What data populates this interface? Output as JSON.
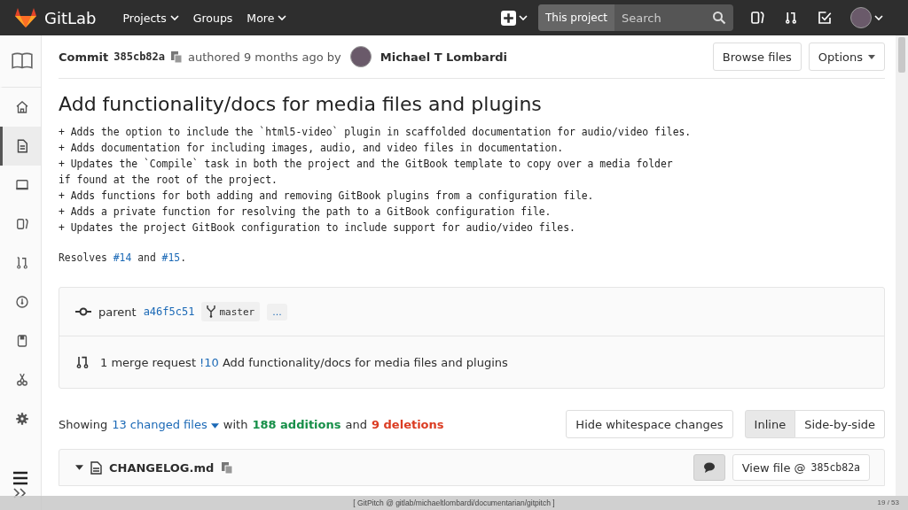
{
  "navbar": {
    "logo": "GitLab",
    "menus": [
      {
        "label": "Projects",
        "dropdown": true
      },
      {
        "label": "Groups",
        "dropdown": false
      },
      {
        "label": "More",
        "dropdown": true
      }
    ],
    "search": {
      "scope": "This project",
      "placeholder": "Search"
    }
  },
  "sidebar": {
    "items": [
      {
        "kind": "book",
        "selected": false
      },
      {
        "kind": "home",
        "selected": false
      },
      {
        "kind": "file",
        "selected": true
      },
      {
        "kind": "monitor",
        "selected": false
      },
      {
        "kind": "board",
        "selected": false
      },
      {
        "kind": "merge",
        "selected": false
      },
      {
        "kind": "gauge",
        "selected": false
      },
      {
        "kind": "snippet",
        "selected": false
      },
      {
        "kind": "scissors",
        "selected": false
      },
      {
        "kind": "gear",
        "selected": false
      }
    ]
  },
  "commit": {
    "label": "Commit",
    "sha": "385cb82a",
    "authored": "authored 9 months ago by",
    "author": "Michael T Lombardi",
    "buttons": [
      {
        "label": "Browse files",
        "dropdown": false
      },
      {
        "label": "Options",
        "dropdown": true
      }
    ]
  },
  "title": "Add functionality/docs for media files and plugins",
  "description": [
    "+ Adds the option to include the `html5-video` plugin in scaffolded documentation for audio/video files.",
    "+ Adds documentation for including images, audio, and video files in documentation.",
    "+ Updates the `Compile` task in both the project and the GitBook template to copy over a media folder",
    "if found at the root of the project.",
    "+ Adds functions for both adding and removing GitBook plugins from a configuration file.",
    "+ Adds a private function for resolving the path to a GitBook configuration file.",
    "+ Updates the project GitBook configuration to include support for audio/video files."
  ],
  "resolves": [
    {
      "kind": "text",
      "text": "Resolves "
    },
    {
      "kind": "link",
      "text": "#14"
    },
    {
      "kind": "text",
      "text": " and "
    },
    {
      "kind": "link",
      "text": "#15"
    },
    {
      "kind": "text",
      "text": "."
    }
  ],
  "info": {
    "parent_label": "parent",
    "parent_sha": "a46f5c51",
    "branch": "master",
    "more": "...",
    "merge_count": "1 merge request",
    "merge_id": "!10",
    "merge_title": "Add functionality/docs for media files and plugins"
  },
  "stats": {
    "showing": "Showing",
    "changed": "13 changed files",
    "with": "with",
    "additions": "188 additions",
    "and": "and",
    "deletions": "9 deletions",
    "whitespace_button": "Hide whitespace changes",
    "views": [
      {
        "label": "Inline",
        "selected": true
      },
      {
        "label": "Side-by-side",
        "selected": false
      }
    ]
  },
  "file": {
    "name": "CHANGELOG.md",
    "view_label": "View file @",
    "view_sha": "385cb82a"
  },
  "footer": {
    "caption": "[ GitPitch @ gitlab/michaeltlombardi/documentarian/gitpitch ]",
    "page": "19 / 53"
  }
}
